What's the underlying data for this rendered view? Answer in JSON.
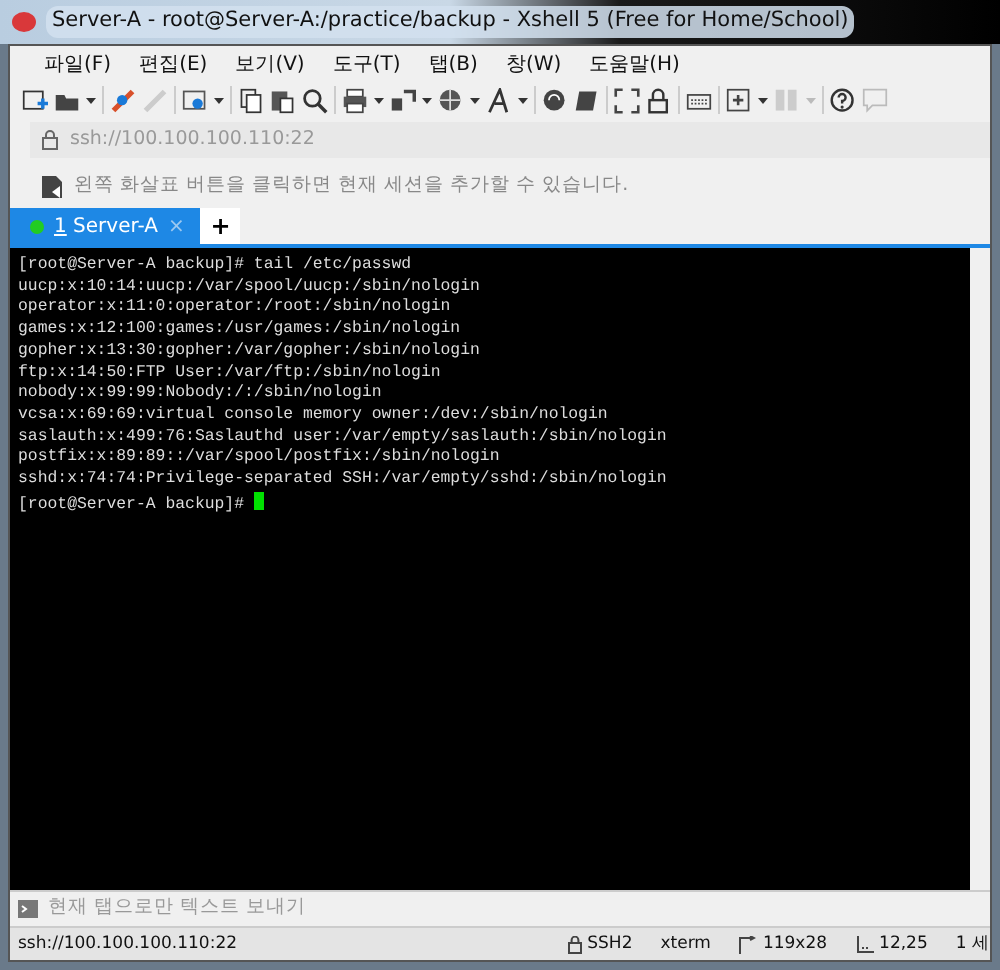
{
  "window": {
    "title": "Server-A - root@Server-A:/practice/backup - Xshell 5 (Free for Home/School)"
  },
  "menu": [
    "파일(F)",
    "편집(E)",
    "보기(V)",
    "도구(T)",
    "탭(B)",
    "창(W)",
    "도움말(H)"
  ],
  "address_bar": {
    "value": "ssh://100.100.100.110:22"
  },
  "hint_bar": {
    "text": "왼쪽 화살표 버튼을 클릭하면 현재 세션을 추가할 수 있습니다."
  },
  "tabs": [
    {
      "mnemonic": "1",
      "label": "Server-A",
      "selected": true,
      "color": "#22cc22",
      "close": "×"
    }
  ],
  "new_tab": "+",
  "terminal": {
    "lines": [
      "[root@Server-A backup]# tail /etc/passwd",
      "uucp:x:10:14:uucp:/var/spool/uucp:/sbin/nologin",
      "operator:x:11:0:operator:/root:/sbin/nologin",
      "games:x:12:100:games:/usr/games:/sbin/nologin",
      "gopher:x:13:30:gopher:/var/gopher:/sbin/nologin",
      "ftp:x:14:50:FTP User:/var/ftp:/sbin/nologin",
      "nobody:x:99:99:Nobody:/:/sbin/nologin",
      "vcsa:x:69:69:virtual console memory owner:/dev:/sbin/nologin",
      "saslauth:x:499:76:Saslauthd user:/var/empty/saslauth:/sbin/nologin",
      "postfix:x:89:89::/var/spool/postfix:/sbin/nologin",
      "sshd:x:74:74:Privilege-separated SSH:/var/empty/sshd:/sbin/nologin",
      "[root@Server-A backup]# "
    ]
  },
  "compose_bar": {
    "text": "현재 탭으로만 텍스트 보내기"
  },
  "status_bar": {
    "address": "ssh://100.100.100.110:22",
    "protocol": "SSH2",
    "terminal_type": "xterm",
    "size": "119x28",
    "cursor": "12,25",
    "sessions": "1 세"
  }
}
